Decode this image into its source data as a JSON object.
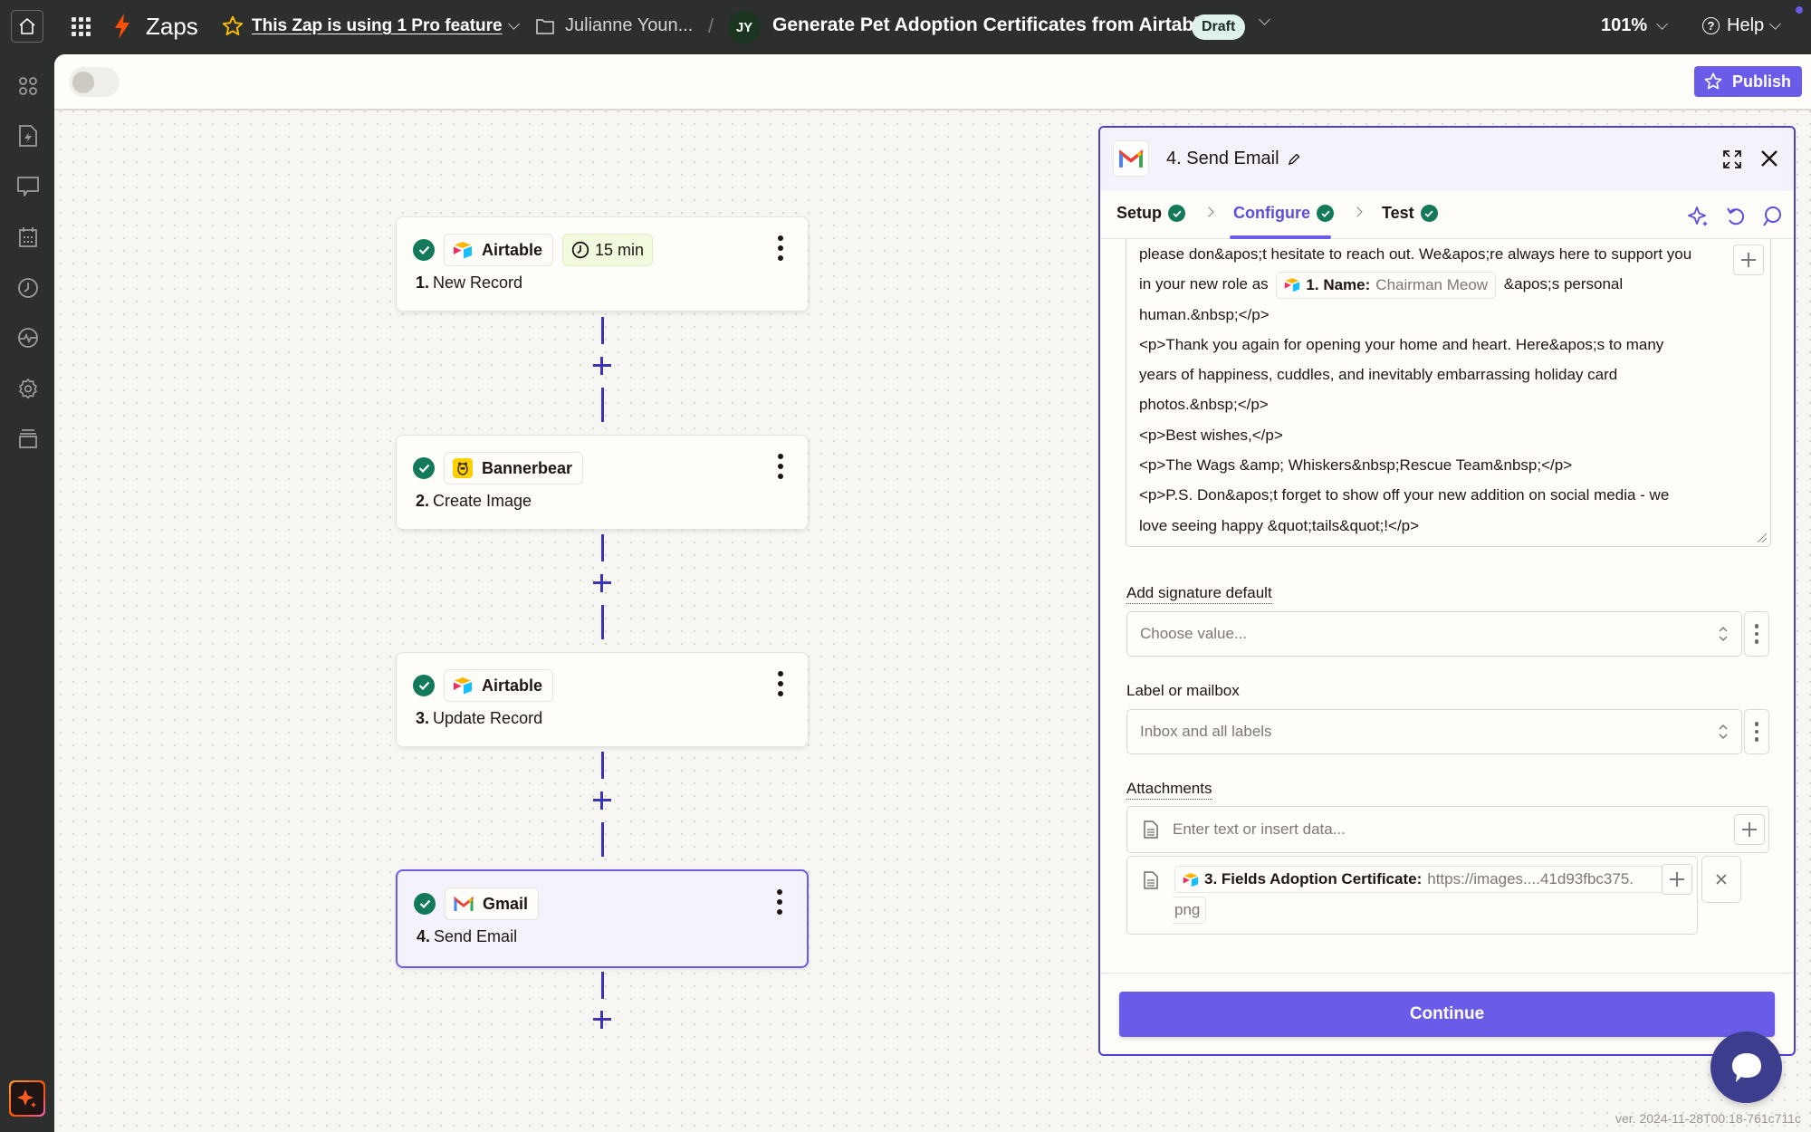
{
  "topbar": {
    "app_name": "Zaps",
    "pro_feature_text": "This Zap is using 1 Pro feature",
    "folder_name": "Julianne Youn...",
    "separator": "/",
    "owner_initials": "JY",
    "zap_title": "Generate Pet Adoption Certificates from Airtable",
    "status_badge": "Draft",
    "zoom_level": "101%",
    "help_label": "Help",
    "colors": {
      "accent": "#6a5ce8",
      "bolt": "#ff4f00",
      "star": "#ffbf00",
      "badge_bg": "#dff3ec"
    }
  },
  "sidebar": {
    "items": [
      {
        "icon": "apps-icon",
        "label": "Apps"
      },
      {
        "icon": "zap-file-icon",
        "label": "Zaps"
      },
      {
        "icon": "chat-icon",
        "label": "Interfaces"
      },
      {
        "icon": "calendar-icon",
        "label": "Tables"
      },
      {
        "icon": "clock-icon",
        "label": "History"
      },
      {
        "icon": "activity-icon",
        "label": "Status"
      },
      {
        "icon": "gear-icon",
        "label": "Settings"
      },
      {
        "icon": "archive-icon",
        "label": "More"
      }
    ],
    "ai_button_icon": "sparkle-icon"
  },
  "canvas": {
    "publish_label": "Publish",
    "toggle_on": false,
    "steps": [
      {
        "number": "1.",
        "title": "New Record",
        "app": "Airtable",
        "app_icon": "airtable-icon",
        "schedule": "15 min",
        "status": "complete",
        "selected": false
      },
      {
        "number": "2.",
        "title": "Create Image",
        "app": "Bannerbear",
        "app_icon": "bannerbear-icon",
        "status": "complete",
        "selected": false
      },
      {
        "number": "3.",
        "title": "Update Record",
        "app": "Airtable",
        "app_icon": "airtable-icon",
        "status": "complete",
        "selected": false
      },
      {
        "number": "4.",
        "title": "Send Email",
        "app": "Gmail",
        "app_icon": "gmail-icon",
        "status": "complete",
        "selected": true
      }
    ]
  },
  "panel": {
    "title": "4. Send Email",
    "tabs": [
      {
        "label": "Setup",
        "complete": true,
        "active": false
      },
      {
        "label": "Configure",
        "complete": true,
        "active": true
      },
      {
        "label": "Test",
        "complete": true,
        "active": false
      }
    ],
    "body": {
      "line1": "please don&apos;t hesitate to reach out. We&apos;re always here to support you",
      "line2_before": "in your new role as",
      "token_label": "1. Name:",
      "token_value": "Chairman Meow",
      "line2_after": "&apos;s personal",
      "line3": "human.&nbsp;</p>",
      "line4": "<p>Thank you again for opening your home and heart. Here&apos;s to many",
      "line5": "years of happiness, cuddles, and inevitably embarrassing holiday card",
      "line6": "photos.&nbsp;</p>",
      "line7": "<p>Best wishes,</p>",
      "line8": "<p>The Wags &amp; Whiskers&nbsp;Rescue Team&nbsp;</p>",
      "line9": "<p>P.S. Don&apos;t forget to show off your new addition on social media - we",
      "line10": "love seeing happy &quot;tails&quot;!</p>"
    },
    "signature": {
      "label": "Add signature default",
      "placeholder": "Choose value..."
    },
    "mailbox": {
      "label": "Label or mailbox",
      "value": "Inbox and all labels"
    },
    "attachments": {
      "label": "Attachments",
      "placeholder": "Enter text or insert data...",
      "item_label": "3. Fields Adoption Certificate:",
      "item_value": "https://images....41d93fbc375.",
      "item_value_tail": "png"
    },
    "continue_label": "Continue"
  },
  "footer": {
    "version": "ver. 2024-11-28T00:18-761c711c"
  }
}
